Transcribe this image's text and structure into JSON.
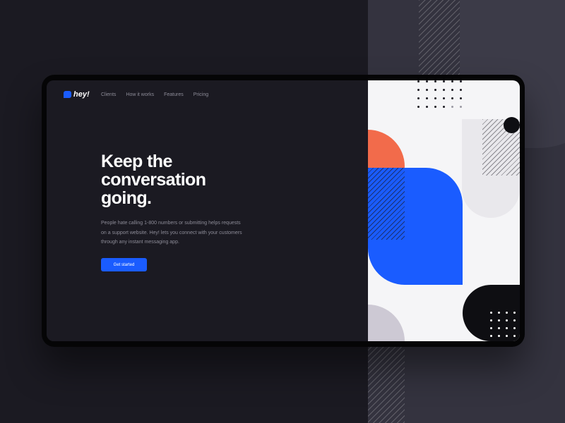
{
  "logo": {
    "text": "hey!"
  },
  "nav": {
    "items": [
      "Clients",
      "How it works",
      "Features",
      "Pricing"
    ]
  },
  "hero": {
    "title_lines": [
      "Keep the",
      "conversation",
      "going."
    ],
    "description": "People hate calling 1-800 numbers or submitting helps requests on a support website. Hey! lets you connect with your customers through any instant messaging app.",
    "cta_label": "Get started"
  },
  "colors": {
    "brand_blue": "#1a5cff",
    "accent_orange": "#f26b4b",
    "page_background": "#1b1a22",
    "art_background": "#f5f5f7"
  },
  "icons": {
    "logo": "hey-logo-icon"
  }
}
